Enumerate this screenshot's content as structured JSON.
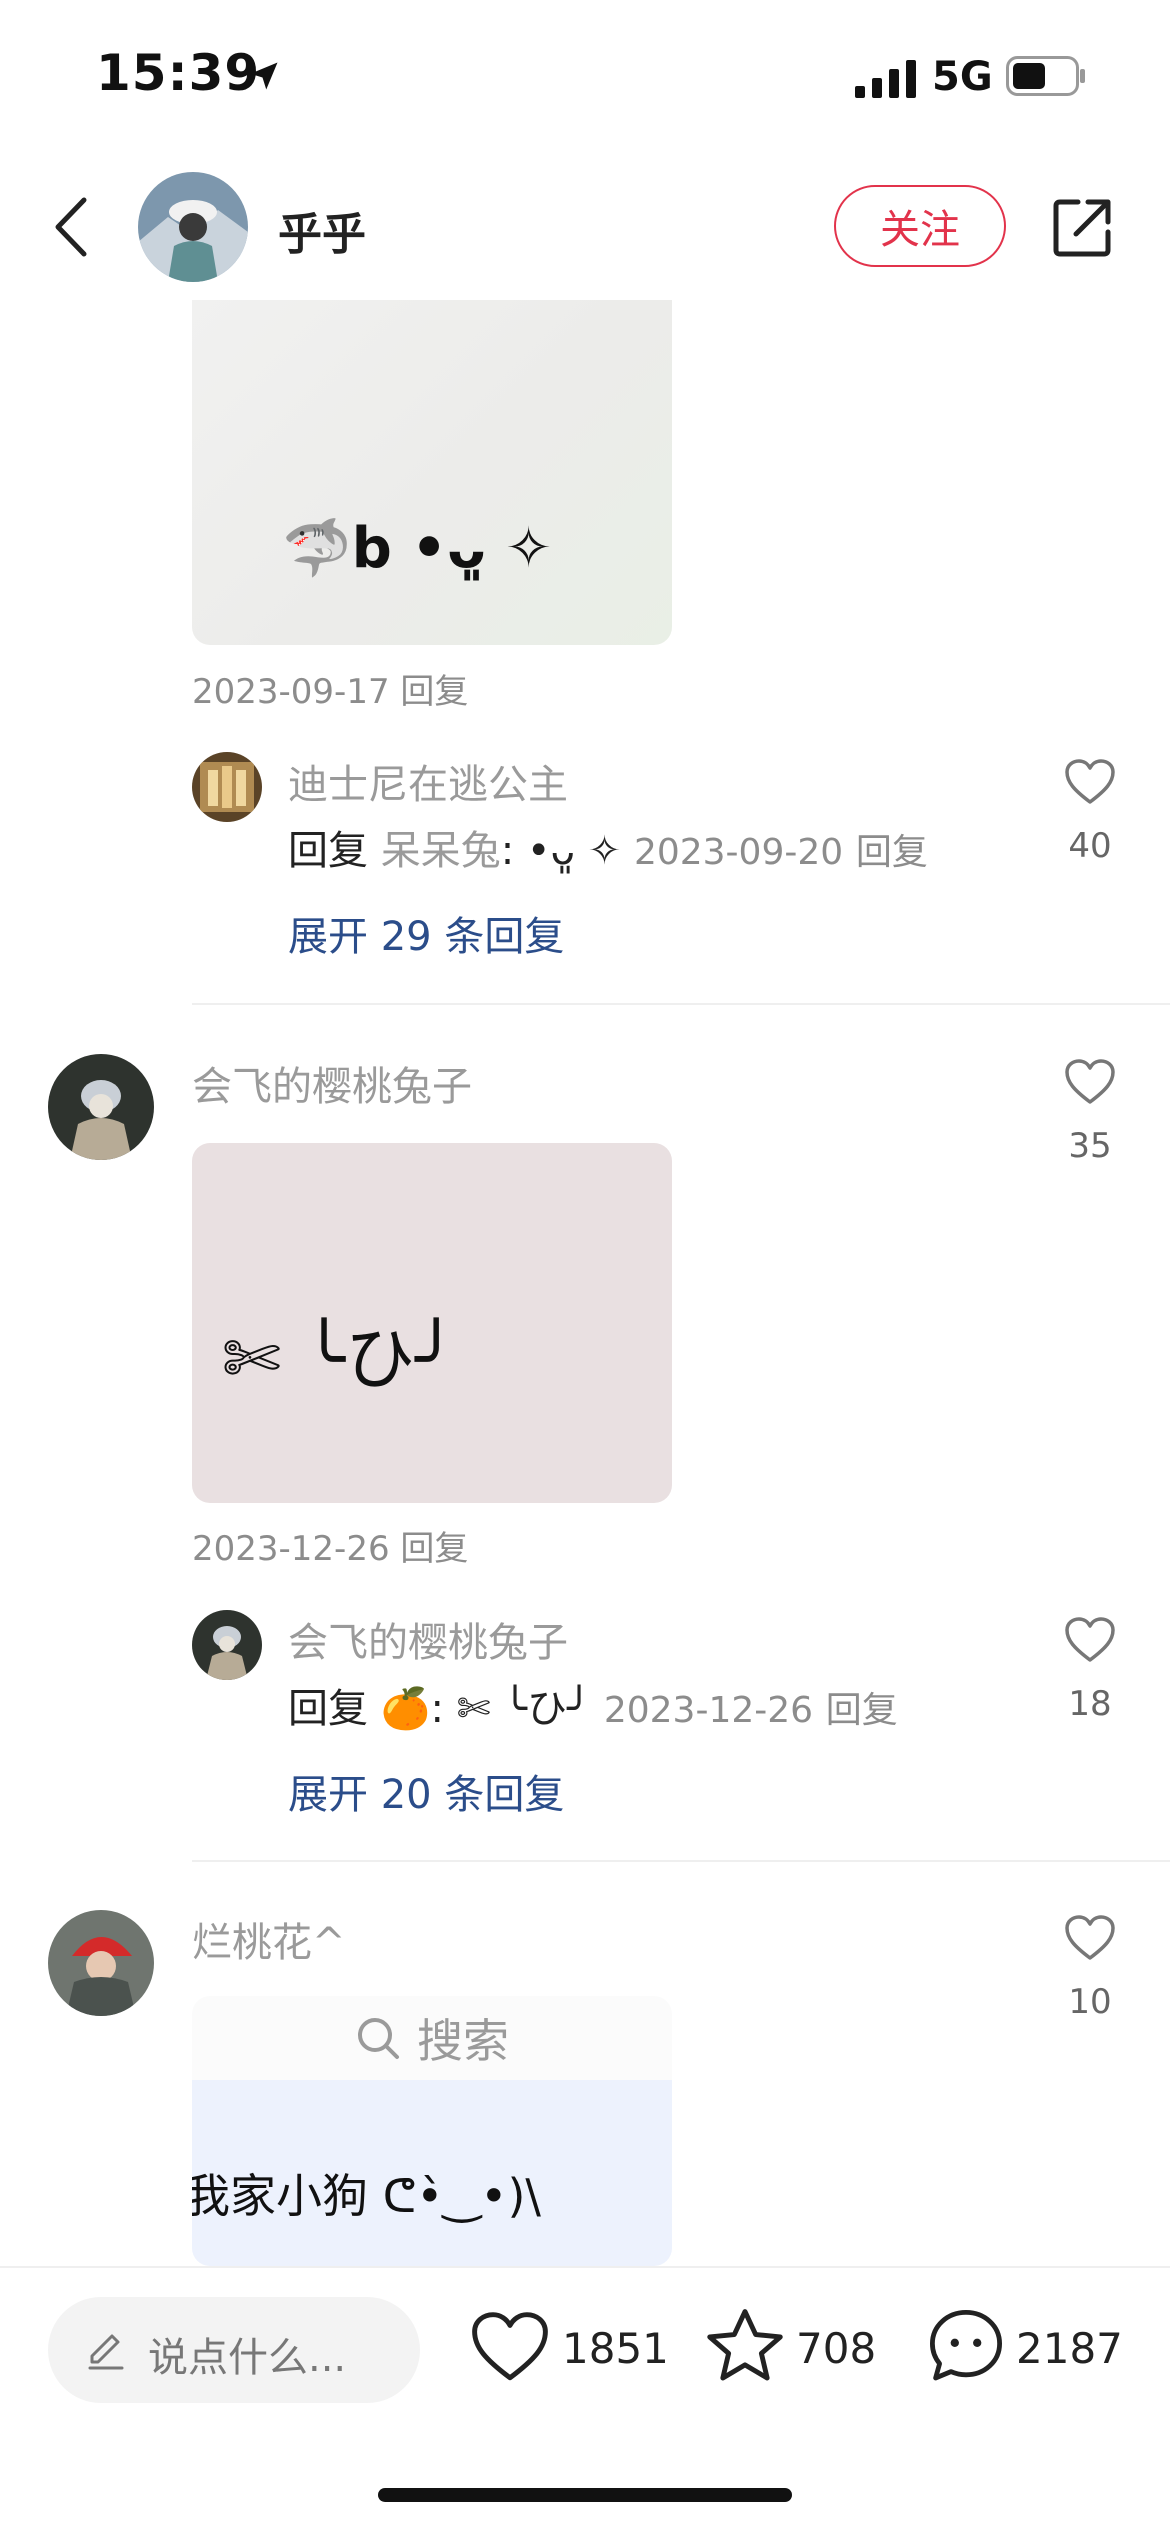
{
  "status_bar": {
    "time": "15:39",
    "network": "5G"
  },
  "header": {
    "username": "乎乎",
    "follow_label": "关注"
  },
  "comments": [
    {
      "image_text": "🦈b •ᴗ͈ ✧",
      "date": "2023-09-17",
      "reply_label": "回复",
      "sub_reply": {
        "username": "迪士尼在逃公主",
        "prefix": "回复",
        "target": "呆呆兔",
        "content": ": •ᴗ͈ ✧",
        "date": "2023-09-20",
        "reply_label": "回复",
        "likes": "40"
      },
      "expand_label": "展开 29 条回复"
    },
    {
      "username": "会飞的樱桃兔子",
      "likes": "35",
      "image_text": "✄ ╰ひ╯",
      "date": "2023-12-26",
      "reply_label": "回复",
      "sub_reply": {
        "username": "会飞的樱桃兔子",
        "prefix": "回复",
        "target": "🍊",
        "content": ": ✄ ╰ひ╯",
        "date": "2023-12-26",
        "reply_label": "回复",
        "likes": "18"
      },
      "expand_label": "展开 20 条回复"
    },
    {
      "username": "烂桃花^",
      "likes": "10",
      "image_search_text": "搜索",
      "image_text": "我家小狗 ᕦ•̀‿•)\\"
    }
  ],
  "bottom_bar": {
    "placeholder": "说点什么...",
    "likes": "1851",
    "stars": "708",
    "comments": "2187"
  },
  "colors": {
    "accent": "#e2334b",
    "link": "#2b4d8a"
  }
}
